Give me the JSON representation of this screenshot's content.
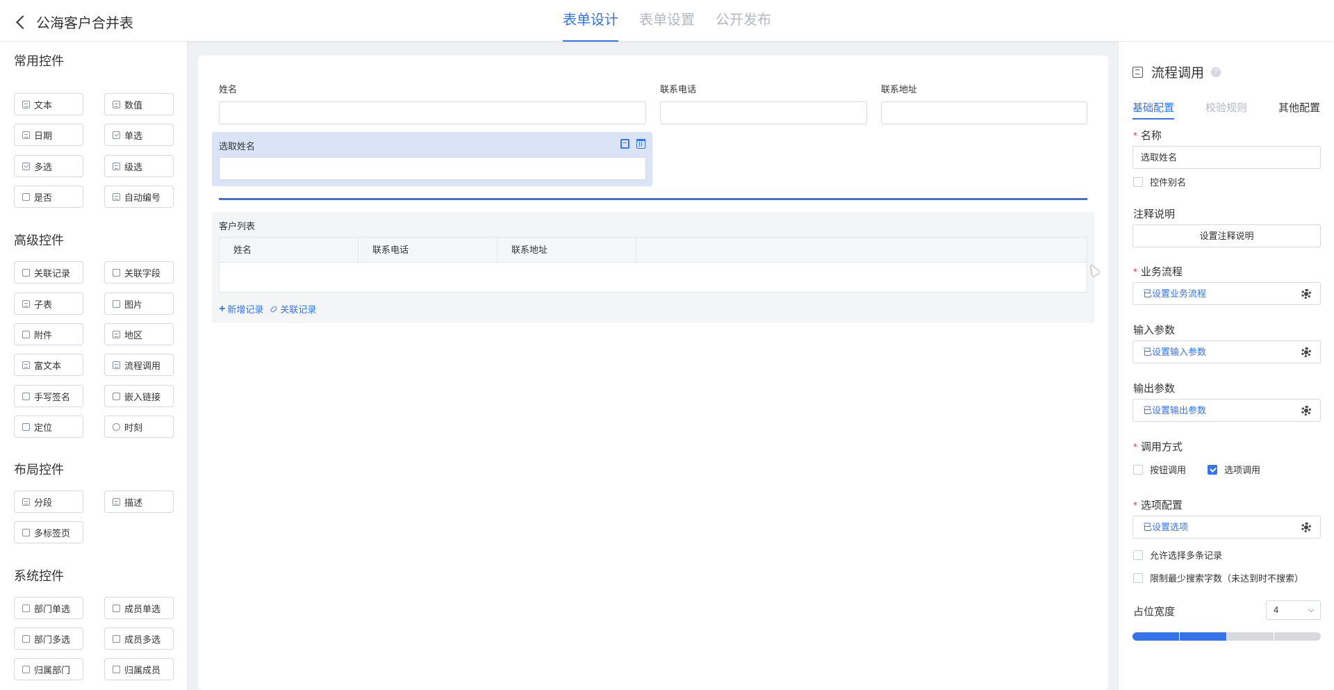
{
  "header": {
    "back_title": "公海客户合并表",
    "tabs": [
      {
        "label": "表单设计",
        "active": true
      },
      {
        "label": "表单设置",
        "active": false
      },
      {
        "label": "公开发布",
        "active": false
      }
    ]
  },
  "sidebar": {
    "groups": [
      {
        "title": "常用控件",
        "items": [
          {
            "label": "文本",
            "icon": "text-icon"
          },
          {
            "label": "数值",
            "icon": "number-icon"
          },
          {
            "label": "日期",
            "icon": "date-icon"
          },
          {
            "label": "单选",
            "icon": "radio-icon"
          },
          {
            "label": "多选",
            "icon": "checkbox-icon"
          },
          {
            "label": "级选",
            "icon": "cascade-icon"
          },
          {
            "label": "是否",
            "icon": "yes-no-icon"
          },
          {
            "label": "自动编号",
            "icon": "auto-number-icon"
          }
        ]
      },
      {
        "title": "高级控件",
        "items": [
          {
            "label": "关联记录",
            "icon": "related-record-icon"
          },
          {
            "label": "关联字段",
            "icon": "related-field-icon"
          },
          {
            "label": "子表",
            "icon": "subtable-icon"
          },
          {
            "label": "图片",
            "icon": "image-icon"
          },
          {
            "label": "附件",
            "icon": "attachment-icon"
          },
          {
            "label": "地区",
            "icon": "region-icon"
          },
          {
            "label": "富文本",
            "icon": "rich-text-icon"
          },
          {
            "label": "流程调用",
            "icon": "process-call-icon"
          },
          {
            "label": "手写签名",
            "icon": "signature-icon"
          },
          {
            "label": "嵌入链接",
            "icon": "embed-link-icon"
          },
          {
            "label": "定位",
            "icon": "location-icon"
          },
          {
            "label": "时刻",
            "icon": "clock-icon"
          }
        ]
      },
      {
        "title": "布局控件",
        "items": [
          {
            "label": "分段",
            "icon": "section-icon"
          },
          {
            "label": "描述",
            "icon": "description-icon"
          },
          {
            "label": "多标签页",
            "icon": "multi-tab-icon"
          }
        ]
      },
      {
        "title": "系统控件",
        "items": [
          {
            "label": "部门单选",
            "icon": "dept-single-icon"
          },
          {
            "label": "成员单选",
            "icon": "member-single-icon"
          },
          {
            "label": "部门多选",
            "icon": "dept-multi-icon"
          },
          {
            "label": "成员多选",
            "icon": "member-multi-icon"
          },
          {
            "label": "归属部门",
            "icon": "owner-dept-icon"
          },
          {
            "label": "归属成员",
            "icon": "owner-member-icon"
          }
        ]
      }
    ]
  },
  "canvas": {
    "fields": [
      {
        "label": "姓名",
        "value": ""
      },
      {
        "label": "联系电话",
        "value": ""
      },
      {
        "label": "联系地址",
        "value": ""
      }
    ],
    "selected_field": {
      "label": "选取姓名",
      "value": ""
    },
    "subform": {
      "title": "客户列表",
      "columns": [
        "姓名",
        "联系电话",
        "联系地址"
      ],
      "add_label": "新增记录",
      "link_label": "关联记录"
    }
  },
  "panel": {
    "title": "流程调用",
    "tabs": [
      {
        "label": "基础配置",
        "active": true
      },
      {
        "label": "校验规则",
        "active": false
      },
      {
        "label": "其他配置",
        "active": false
      }
    ],
    "name_label": "名称",
    "name_value": "选取姓名",
    "alias_label": "控件别名",
    "alias_checked": false,
    "note_label": "注释说明",
    "note_button": "设置注释说明",
    "process_label": "业务流程",
    "process_value": "已设置业务流程",
    "input_label": "输入参数",
    "input_value": "已设置输入参数",
    "output_label": "输出参数",
    "output_value": "已设置输出参数",
    "call_mode_label": "调用方式",
    "call_modes": [
      {
        "label": "按钮调用",
        "checked": false
      },
      {
        "label": "选项调用",
        "checked": true
      }
    ],
    "option_config_label": "选项配置",
    "option_config_value": "已设置选项",
    "allow_multi_label": "允许选择多条记录",
    "allow_multi_checked": false,
    "min_search_label": "限制最少搜索字数（未达到时不搜索）",
    "min_search_checked": false,
    "width_label": "占位宽度",
    "width_value": "4",
    "width_fraction": 0.5
  },
  "colors": {
    "accent": "#3574e8",
    "required": "#e84a4a",
    "selected_bg": "#dbe3f7"
  }
}
